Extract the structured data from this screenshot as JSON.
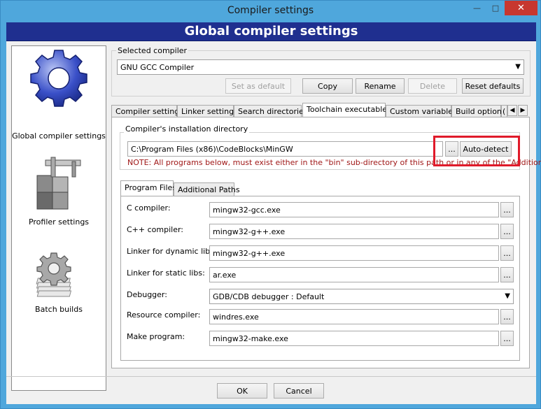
{
  "window": {
    "title": "Compiler settings",
    "controls": {
      "minimize": "—",
      "maximize": "□",
      "close": "✕"
    }
  },
  "header": {
    "title": "Global compiler settings"
  },
  "sidebar": {
    "items": [
      {
        "label": "Global compiler settings",
        "icon": "gear-icon",
        "selected": true
      },
      {
        "label": "Profiler settings",
        "icon": "profiler-icon",
        "selected": false
      },
      {
        "label": "Batch builds",
        "icon": "batch-gears-icon",
        "selected": false
      }
    ]
  },
  "selected_compiler": {
    "legend": "Selected compiler",
    "value": "GNU GCC Compiler",
    "buttons": {
      "set_default": "Set as default",
      "copy": "Copy",
      "rename": "Rename",
      "delete": "Delete",
      "reset_defaults": "Reset defaults"
    }
  },
  "tabs": [
    {
      "label": "Compiler settings",
      "active": false
    },
    {
      "label": "Linker settings",
      "active": false
    },
    {
      "label": "Search directories",
      "active": false
    },
    {
      "label": "Toolchain executables",
      "active": true
    },
    {
      "label": "Custom variables",
      "active": false
    },
    {
      "label": "Build options",
      "active": false
    },
    {
      "label": "(",
      "active": false
    }
  ],
  "tab_scroll": {
    "left": "◀",
    "right": "▶"
  },
  "install_dir": {
    "legend": "Compiler's installation directory",
    "value": "C:\\Program Files (x86)\\CodeBlocks\\MinGW",
    "browse_label": "...",
    "autodetect_label": "Auto-detect",
    "note": "NOTE: All programs below, must exist either in the \"bin\" sub-directory of this path or in any of the \"Additional"
  },
  "inner_tabs": [
    {
      "label": "Program Files",
      "active": true
    },
    {
      "label": "Additional Paths",
      "active": false
    }
  ],
  "programs": {
    "c_compiler": {
      "label": "C compiler:",
      "value": "mingw32-gcc.exe"
    },
    "cpp_compiler": {
      "label": "C++ compiler:",
      "value": "mingw32-g++.exe"
    },
    "linker_dynamic": {
      "label": "Linker for dynamic libs:",
      "value": "mingw32-g++.exe"
    },
    "linker_static": {
      "label": "Linker for static libs:",
      "value": "ar.exe"
    },
    "debugger": {
      "label": "Debugger:",
      "value": "GDB/CDB debugger : Default"
    },
    "resource_compiler": {
      "label": "Resource compiler:",
      "value": "windres.exe"
    },
    "make_program": {
      "label": "Make program:",
      "value": "mingw32-make.exe"
    },
    "browse_label": "..."
  },
  "dialog_buttons": {
    "ok": "OK",
    "cancel": "Cancel"
  },
  "colors": {
    "header_band": "#1f2f8f",
    "title_bar": "#4fa7dc",
    "close_button": "#c7372f",
    "highlight_box": "#e01a2a",
    "note_text": "#a01818"
  }
}
